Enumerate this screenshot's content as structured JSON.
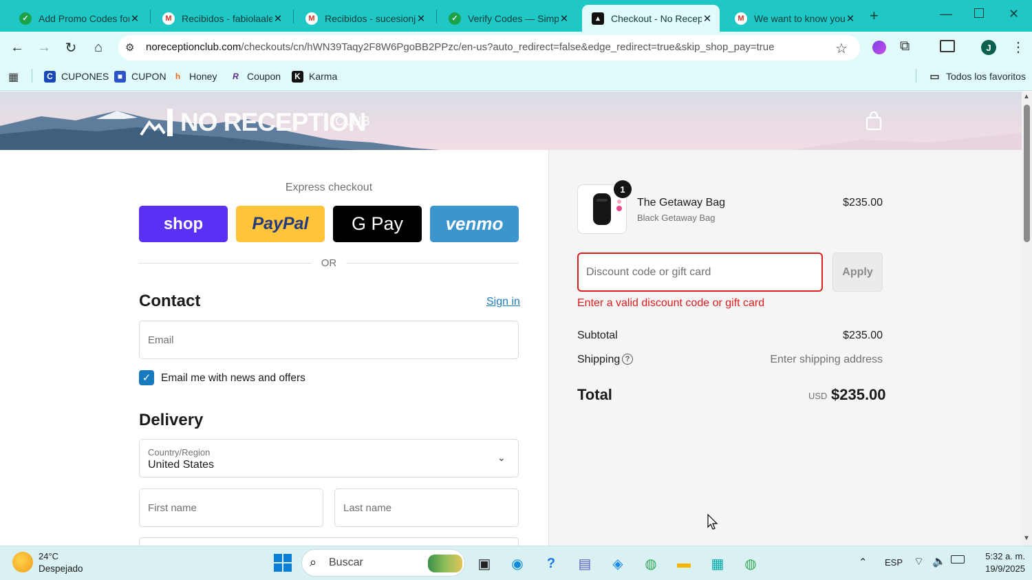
{
  "browser": {
    "tabs": [
      {
        "title": "Add Promo Codes for",
        "favicon": "simplycodes-icon",
        "color": "#1ba34a"
      },
      {
        "title": "Recibidos - fabiolaalej",
        "favicon": "gmail-icon",
        "color": "#d93025"
      },
      {
        "title": "Recibidos - sucesionjo",
        "favicon": "gmail-icon",
        "color": "#d93025"
      },
      {
        "title": "Verify Codes — Simply",
        "favicon": "simplycodes-icon",
        "color": "#1ba34a"
      },
      {
        "title": "Checkout - No Recept",
        "favicon": "noreception-icon",
        "color": "#111111",
        "active": true
      },
      {
        "title": "We want to know you",
        "favicon": "gmail-icon",
        "color": "#d93025"
      }
    ],
    "url_host": "noreceptionclub.com",
    "url_rest": "/checkouts/cn/hWN39Taqy2F8W6PgoBB2PPzc/en-us?auto_redirect=false&edge_redirect=true&skip_shop_pay=true",
    "profile_initial": "J",
    "bookmarks": [
      {
        "label": "CUPONES",
        "icon": "cupones-icon",
        "color": "#1a47b8"
      },
      {
        "label": "CUPON",
        "icon": "lock-icon",
        "color": "#2a53c7"
      },
      {
        "label": "Honey",
        "icon": "honey-icon",
        "color": "#f26b1d"
      },
      {
        "label": "Coupon",
        "icon": "coupon-icon",
        "color": "#5a2d82"
      },
      {
        "label": "Karma",
        "icon": "karma-icon",
        "color": "#111111"
      }
    ],
    "all_bookmarks": "Todos los favoritos"
  },
  "store": {
    "logo": "NO RECEPTION",
    "logo_sub": "CLUB"
  },
  "checkout": {
    "express_label": "Express checkout",
    "pay_buttons": [
      "shop",
      "PayPal",
      "G Pay",
      "venmo"
    ],
    "or_text": "OR",
    "contact_title": "Contact",
    "signin": "Sign in",
    "email_placeholder": "Email",
    "news_label": "Email me with news and offers",
    "news_checked": true,
    "delivery_title": "Delivery",
    "country_label": "Country/Region",
    "country_value": "United States",
    "first_name_placeholder": "First name",
    "last_name_placeholder": "Last name"
  },
  "summary": {
    "qty": "1",
    "product_name": "The Getaway Bag",
    "product_variant": "Black Getaway Bag",
    "product_price": "$235.00",
    "discount_placeholder": "Discount code or gift card",
    "apply": "Apply",
    "error": "Enter a valid discount code or gift card",
    "subtotal_label": "Subtotal",
    "subtotal_value": "$235.00",
    "shipping_label": "Shipping",
    "shipping_value": "Enter shipping address",
    "total_label": "Total",
    "currency": "USD",
    "total_value": "$235.00"
  },
  "taskbar": {
    "temp": "24°C",
    "weather": "Despejado",
    "search": "Buscar",
    "lang": "ESP",
    "time": "5:32 a. m.",
    "date": "19/9/2025"
  }
}
